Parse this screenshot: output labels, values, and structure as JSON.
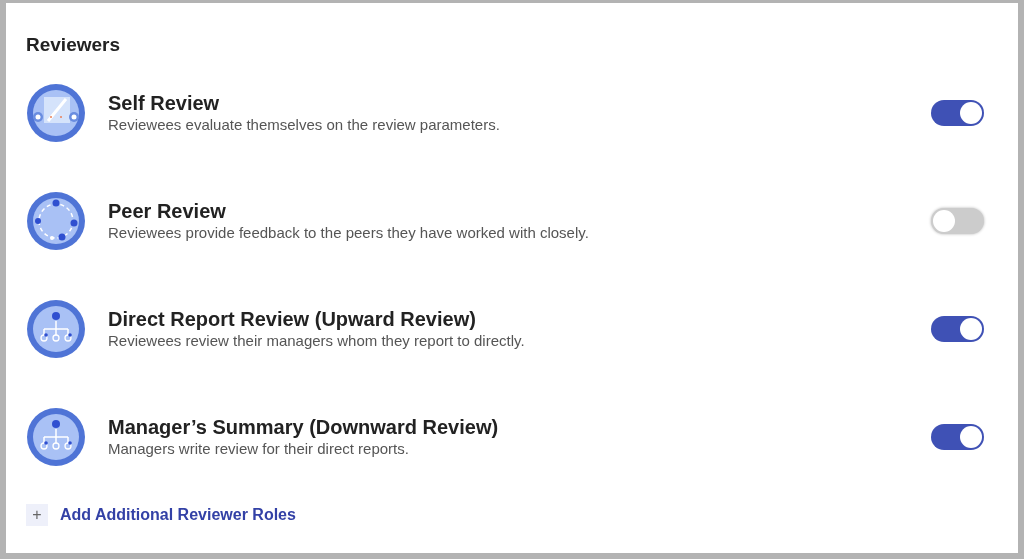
{
  "title": "Reviewers",
  "reviewers": [
    {
      "kind": "self",
      "name": "Self Review",
      "description": "Reviewees evaluate themselves on the review parameters.",
      "on": true
    },
    {
      "kind": "peer",
      "name": "Peer Review",
      "description": "Reviewees provide feedback to the peers they have worked with closely.",
      "on": false
    },
    {
      "kind": "hierarchy",
      "name": "Direct Report Review (Upward Review)",
      "description": "Reviewees review their managers whom they report to directly.",
      "on": true
    },
    {
      "kind": "hierarchy",
      "name": "Manager’s Summary (Downward Review)",
      "description": "Managers write review for their direct reports.",
      "on": true
    }
  ],
  "add_link": {
    "icon": "+",
    "label": "Add Additional Reviewer Roles"
  }
}
